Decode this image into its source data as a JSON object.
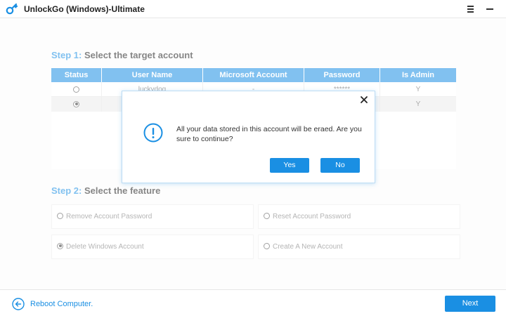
{
  "window": {
    "title": "UnlockGo (Windows)-Ultimate"
  },
  "step1": {
    "label": "Step 1:",
    "title": " Select the target account"
  },
  "table": {
    "headers": [
      "Status",
      "User Name",
      "Microsoft Account",
      "Password",
      "Is Admin"
    ],
    "rows": [
      {
        "selected": false,
        "user": "luckydog",
        "microsoft": "-",
        "password": "******",
        "admin": "Y"
      },
      {
        "selected": true,
        "user": "",
        "microsoft": "",
        "password": "",
        "admin": "Y"
      }
    ]
  },
  "step2": {
    "label": "Step 2:",
    "title": " Select the feature"
  },
  "features": [
    {
      "label": "Remove Account Password",
      "selected": false
    },
    {
      "label": "Reset Account Password",
      "selected": false
    },
    {
      "label": "Delete Windows Account",
      "selected": true
    },
    {
      "label": "Create A New Account",
      "selected": false
    }
  ],
  "footer": {
    "reboot_label": "Reboot Computer.",
    "next_label": "Next"
  },
  "dialog": {
    "message": "All your data stored in this account will be eraed. Are you sure to continue?",
    "yes_label": "Yes",
    "no_label": "No"
  },
  "colors": {
    "accent": "#1a8fe3",
    "selected_row": "#ececec"
  },
  "icons": {
    "app": "app-logo-icon",
    "menu": "hamburger-menu-icon",
    "minimize": "minimize-icon",
    "back": "arrow-left-circle-icon",
    "close": "close-x-icon",
    "warning": "exclamation-circle-icon"
  }
}
